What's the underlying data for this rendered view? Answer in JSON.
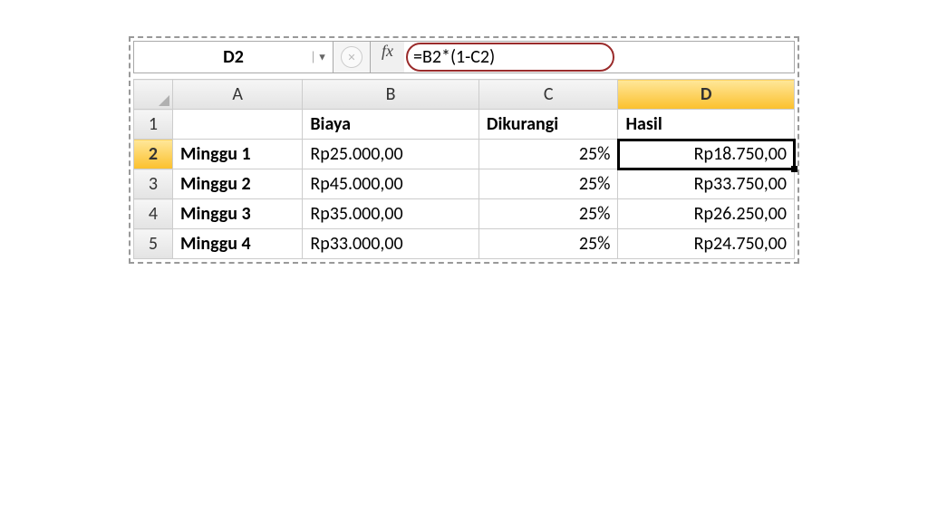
{
  "nameBox": {
    "value": "D2"
  },
  "fx": {
    "label": "fx"
  },
  "formula": {
    "value": "=B2*(1-C2)"
  },
  "columns": [
    "A",
    "B",
    "C",
    "D"
  ],
  "activeColumn": "D",
  "activeRow": "2",
  "headers": {
    "A": "",
    "B": "Biaya",
    "C": "Dikurangi",
    "D": "Hasil"
  },
  "rows": [
    {
      "n": "2",
      "A": "Minggu 1",
      "B": "Rp25.000,00",
      "C": "25%",
      "D": "Rp18.750,00"
    },
    {
      "n": "3",
      "A": "Minggu 2",
      "B": "Rp45.000,00",
      "C": "25%",
      "D": "Rp33.750,00"
    },
    {
      "n": "4",
      "A": "Minggu 3",
      "B": "Rp35.000,00",
      "C": "25%",
      "D": "Rp26.250,00"
    },
    {
      "n": "5",
      "A": "Minggu 4",
      "B": "Rp33.000,00",
      "C": "25%",
      "D": "Rp24.750,00"
    }
  ],
  "chart_data": {
    "type": "table",
    "title": "",
    "columns": [
      "",
      "Biaya",
      "Dikurangi",
      "Hasil"
    ],
    "rows": [
      [
        "Minggu 1",
        25000,
        0.25,
        18750
      ],
      [
        "Minggu 2",
        45000,
        0.25,
        33750
      ],
      [
        "Minggu 3",
        35000,
        0.25,
        26250
      ],
      [
        "Minggu 4",
        33000,
        0.25,
        24750
      ]
    ],
    "currency": "Rp",
    "formula_D": "=B*(1-C)"
  }
}
